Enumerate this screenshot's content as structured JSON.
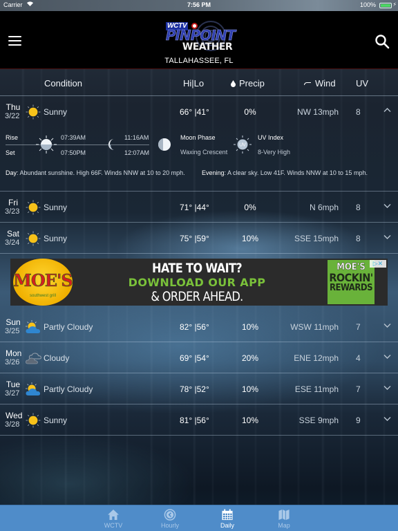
{
  "status_bar": {
    "carrier": "Carrier",
    "time": "7:56 PM",
    "battery_percent": "100%",
    "battery_level": 1.0
  },
  "header": {
    "logo_top": "WCTV",
    "logo_middle": "PINPOINT",
    "logo_bottom": "WEATHER",
    "location": "TALLAHASSEE, FL",
    "menu_icon": "hamburger-menu-icon",
    "search_icon": "search-icon"
  },
  "columns": {
    "condition": "Condition",
    "hilo": "Hi|Lo",
    "precip": "Precip",
    "wind": "Wind",
    "uv": "UV"
  },
  "days": [
    {
      "day": "Thu",
      "date": "3/22",
      "icon": "sunny",
      "condition": "Sunny",
      "hilo": "66° |41°",
      "precip": "0%",
      "wind": "NW 13mph",
      "uv": "8",
      "expanded": true
    },
    {
      "day": "Fri",
      "date": "3/23",
      "icon": "sunny",
      "condition": "Sunny",
      "hilo": "71° |44°",
      "precip": "0%",
      "wind": "N 6mph",
      "uv": "8",
      "expanded": false
    },
    {
      "day": "Sat",
      "date": "3/24",
      "icon": "sunny",
      "condition": "Sunny",
      "hilo": "75° |59°",
      "precip": "10%",
      "wind": "SSE 15mph",
      "uv": "8",
      "expanded": false
    },
    {
      "day": "Sun",
      "date": "3/25",
      "icon": "partly-cloudy",
      "condition": "Partly Cloudy",
      "hilo": "82° |56°",
      "precip": "10%",
      "wind": "WSW 11mph",
      "uv": "7",
      "expanded": false
    },
    {
      "day": "Mon",
      "date": "3/26",
      "icon": "cloudy",
      "condition": "Cloudy",
      "hilo": "69° |54°",
      "precip": "20%",
      "wind": "ENE 12mph",
      "uv": "4",
      "expanded": false
    },
    {
      "day": "Tue",
      "date": "3/27",
      "icon": "partly-cloudy",
      "condition": "Partly Cloudy",
      "hilo": "78° |52°",
      "precip": "10%",
      "wind": "ESE 11mph",
      "uv": "7",
      "expanded": false
    },
    {
      "day": "Wed",
      "date": "3/28",
      "icon": "sunny",
      "condition": "Sunny",
      "hilo": "81° |56°",
      "precip": "10%",
      "wind": "SSE 9mph",
      "uv": "9",
      "expanded": false
    }
  ],
  "detail": {
    "rise_label": "Rise",
    "set_label": "Set",
    "sunrise": "07:39AM",
    "sunset": "07:50PM",
    "moonrise": "11:16AM",
    "moonset": "12:07AM",
    "moon_phase_label": "Moon Phase",
    "moon_phase": "Waxing Crescent",
    "uv_index_label": "UV Index",
    "uv_index": "8-Very High",
    "uv_icon_text": "UV",
    "day_label": "Day",
    "day_text": ": Abundant sunshine. High 66F. Winds NNW at 10 to 20 mph.",
    "evening_label": "Evening",
    "evening_text": ": A clear sky. Low 41F. Winds NNW at 10 to 15 mph."
  },
  "ad": {
    "brand": "MOE'S",
    "brand_sub": "southwest grill",
    "line1": "HATE TO WAIT?",
    "line2": "DOWNLOAD OUR APP",
    "line3": "& ORDER AHEAD.",
    "right_1": "MOE'S",
    "right_2": "ROCKIN'",
    "right_3": "REWARDS",
    "adchoices": "▷✕"
  },
  "tabs": [
    {
      "label": "WCTV",
      "icon": "home-icon",
      "active": false
    },
    {
      "label": "Hourly",
      "icon": "clock-icon",
      "active": false
    },
    {
      "label": "Daily",
      "icon": "calendar-icon",
      "active": true
    },
    {
      "label": "Map",
      "icon": "map-icon",
      "active": false
    }
  ],
  "colors": {
    "tab_bar": "#4f8cc9",
    "sun": "#f7c21a",
    "cloud_blue": "#2f86d0",
    "ad_green": "#7ac13a"
  }
}
